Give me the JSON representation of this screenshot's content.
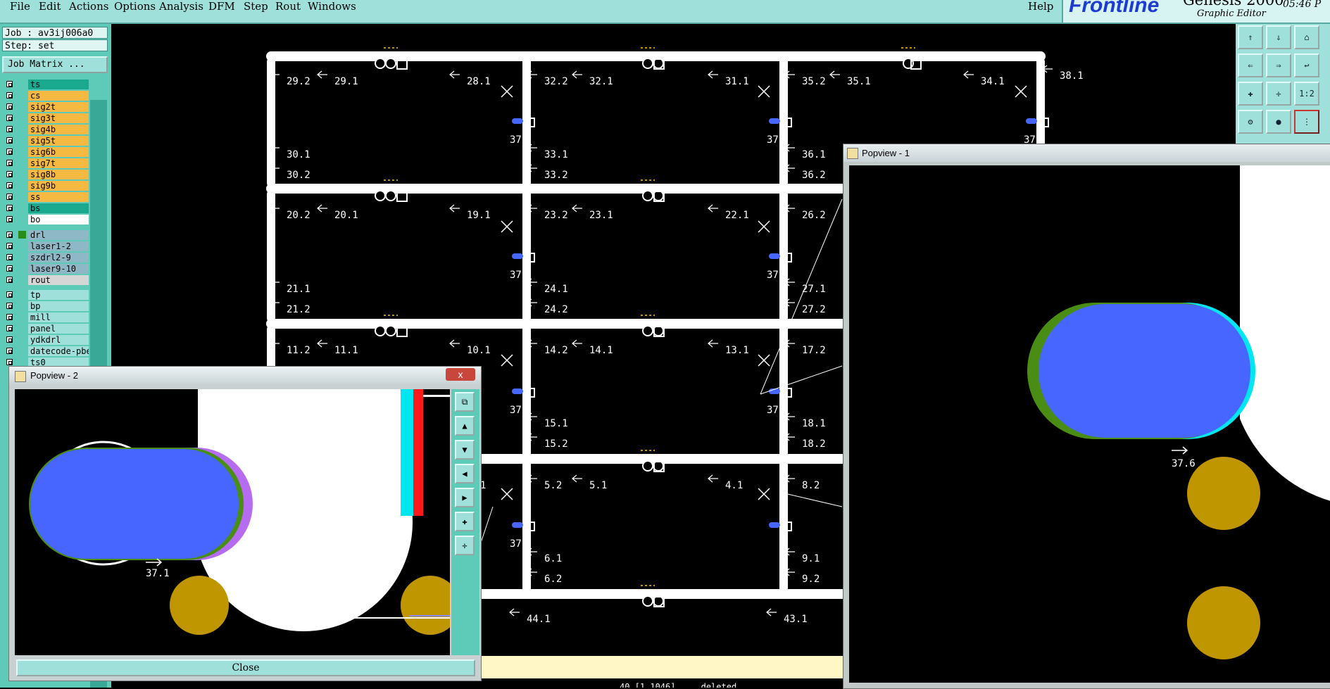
{
  "menu": {
    "items": [
      "File",
      "Edit",
      "Actions",
      "Options",
      "Analysis",
      "DFM",
      "Step",
      "Rout",
      "Windows"
    ],
    "help": "Help"
  },
  "brand": {
    "logo": "Frontline",
    "product": "Genesis 2000",
    "subtitle": "Graphic Editor",
    "clock": "05:46 P"
  },
  "panel": {
    "job": "Job : av3ij006a0",
    "step": "Step: set",
    "job_matrix_button": "Job Matrix ...",
    "layers": [
      {
        "name": "ts",
        "color": "#1aa88f"
      },
      {
        "name": "cs",
        "color": "#f5b843"
      },
      {
        "name": "sig2t",
        "color": "#f5b843"
      },
      {
        "name": "sig3t",
        "color": "#f5b843"
      },
      {
        "name": "sig4b",
        "color": "#f5b843"
      },
      {
        "name": "sig5t",
        "color": "#f5b843"
      },
      {
        "name": "sig6b",
        "color": "#f5b843"
      },
      {
        "name": "sig7t",
        "color": "#f5b843"
      },
      {
        "name": "sig8b",
        "color": "#f5b843"
      },
      {
        "name": "sig9b",
        "color": "#f5b843"
      },
      {
        "name": "ss",
        "color": "#f5b843"
      },
      {
        "name": "bs",
        "color": "#1aa88f"
      },
      {
        "name": "bo",
        "color": "#ffffff"
      },
      {
        "name": "drl",
        "color": "#8fb8c6"
      },
      {
        "name": "laser1-2",
        "color": "#8fb8c6"
      },
      {
        "name": "szdrl2-9",
        "color": "#8fb8c6"
      },
      {
        "name": "laser9-10",
        "color": "#8fb8c6"
      },
      {
        "name": "rout",
        "color": "#d6d6d6"
      },
      {
        "name": "tp",
        "color": "#9fe0da"
      },
      {
        "name": "bp",
        "color": "#9fe0da"
      },
      {
        "name": "mill",
        "color": "#9fe0da"
      },
      {
        "name": "panel",
        "color": "#9fe0da"
      },
      {
        "name": "ydkdrl",
        "color": "#9fe0da"
      },
      {
        "name": "datecode-pbe",
        "color": "#9fe0da"
      },
      {
        "name": "ts0",
        "color": "#9fe0da"
      }
    ]
  },
  "canvas": {
    "labels": [
      "29.2",
      "29.1",
      "28.1",
      "32.2",
      "32.1",
      "31.1",
      "35.2",
      "35.1",
      "34.1",
      "38.1",
      "30.1",
      "30.2",
      "33.1",
      "33.2",
      "36.1",
      "36.2",
      "20.2",
      "20.1",
      "19.1",
      "23.2",
      "23.1",
      "22.1",
      "26.2",
      "21.1",
      "21.2",
      "24.1",
      "24.2",
      "27.1",
      "27.2",
      "11.2",
      "11.1",
      "10.1",
      "14.2",
      "14.1",
      "13.1",
      "17.2",
      "15.1",
      "15.2",
      "18.1",
      "18.2",
      "1",
      "5.2",
      "5.1",
      "4.1",
      "8.2",
      "6.1",
      "6.2",
      "9.1",
      "9.2",
      "44.1",
      "43.1",
      "37.",
      "37.",
      "37.",
      "37.",
      "37.",
      "37.",
      "37.",
      "37."
    ],
    "status_fragment": "40 [1.1046]  ...  deleted"
  },
  "popview1": {
    "title": "Popview - 1",
    "pad_label": "37.6"
  },
  "popview2": {
    "title": "Popview - 2",
    "pad_label": "37.1",
    "close_label": "Close",
    "x": "x"
  },
  "colors": {
    "pad_blue": "#4766ff",
    "gold": "#bf9500",
    "purple": "#b56cf0",
    "green": "#4a8d14",
    "cyan": "#00e6f0",
    "red": "#ff1a1a"
  }
}
